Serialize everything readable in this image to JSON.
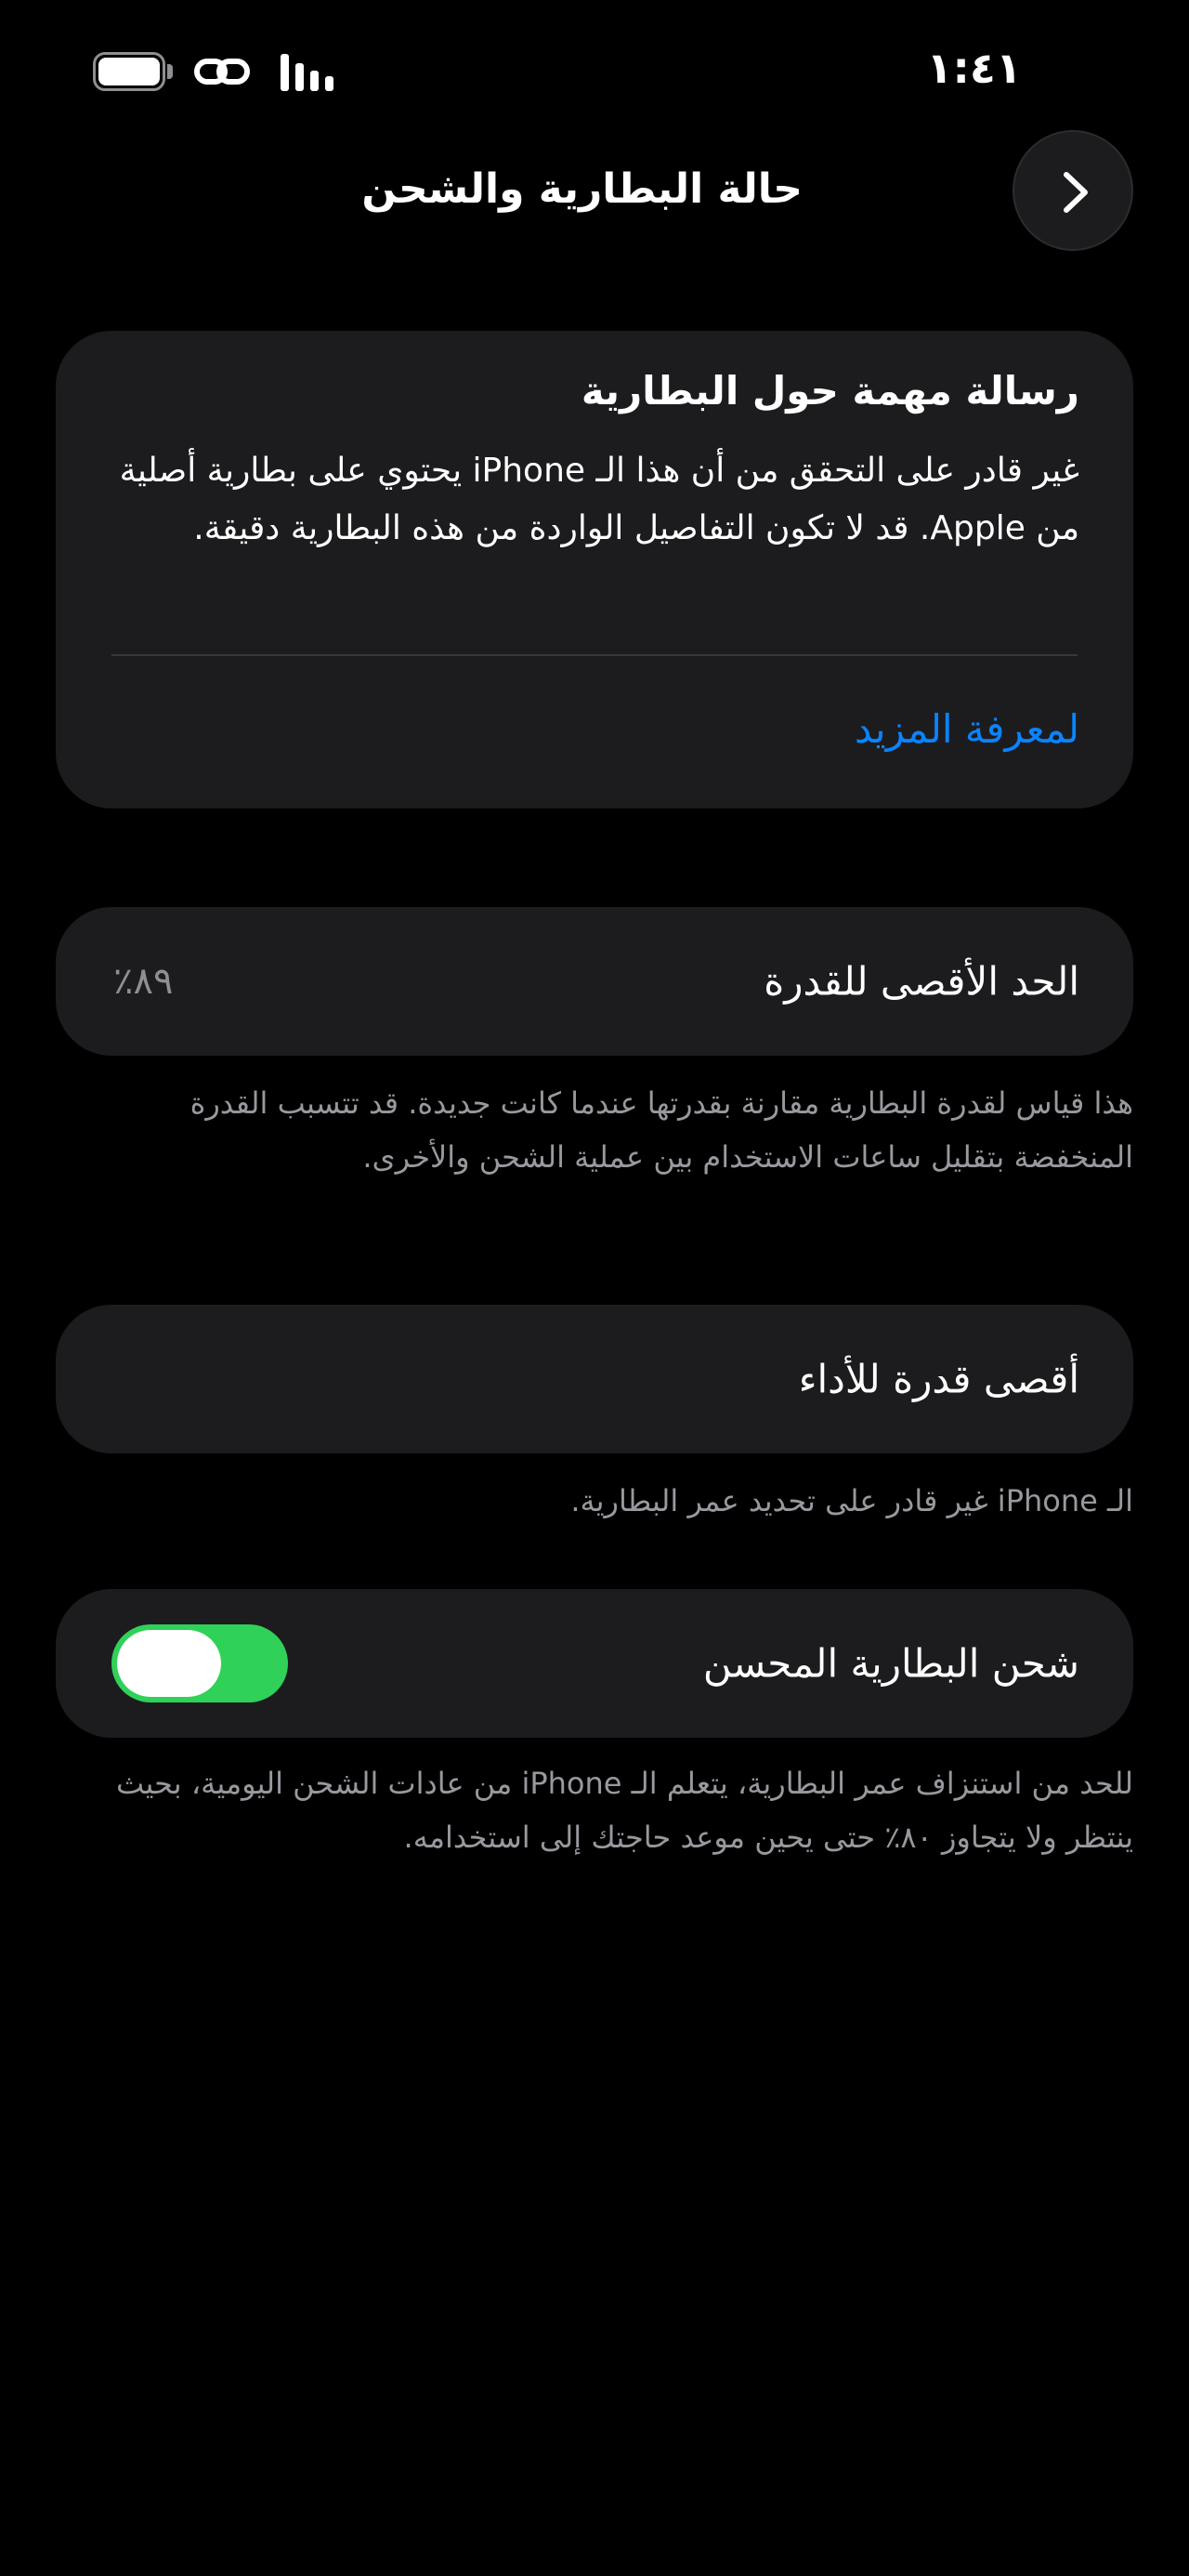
{
  "status_bar": {
    "time": "١:٤١",
    "battery_level": 1.0,
    "icons": [
      "battery-icon",
      "link-icon",
      "signal-icon"
    ]
  },
  "header": {
    "title": "حالة البطارية والشحن",
    "back_icon": "chevron-right-icon"
  },
  "battery_message": {
    "title": "رسالة مهمة حول البطارية",
    "body": "غير قادر على التحقق من أن هذا الـ iPhone يحتوي على بطارية أصلية من Apple. قد لا تكون التفاصيل الواردة من هذه البطارية دقيقة.",
    "link": "لمعرفة المزيد"
  },
  "maximum_capacity": {
    "label": "الحد الأقصى للقدرة",
    "value": "٨٩٪",
    "footnote": "هذا قياس لقدرة البطارية مقارنة بقدرتها عندما كانت جديدة. قد تتسبب القدرة المنخفضة بتقليل ساعات الاستخدام بين عملية الشحن والأخرى."
  },
  "peak_performance": {
    "label": "أقصى قدرة للأداء",
    "footnote": "الـ iPhone غير قادر على تحديد عمر البطارية."
  },
  "optimized_charging": {
    "label": "شحن البطارية المحسن",
    "enabled": true,
    "footnote": "للحد من استنزاف عمر البطارية، يتعلم الـ iPhone من عادات الشحن اليومية، بحيث ينتظر ولا يتجاوز ٨٠٪ حتى يحين موعد حاجتك إلى استخدامه."
  },
  "colors": {
    "background": "#000000",
    "card": "#1c1c1e",
    "link": "#0a84ff",
    "toggle_on": "#30d158",
    "secondary_text": "#98989e"
  }
}
